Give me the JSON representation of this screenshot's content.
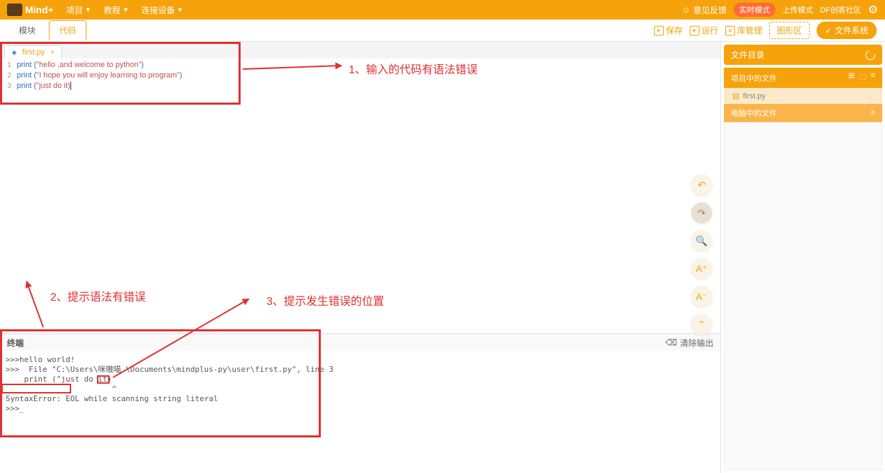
{
  "header": {
    "logo": "Mind+",
    "menu": {
      "project": "项目",
      "tutorial": "教程",
      "connect": "连接设备"
    },
    "feedback": "意见反馈",
    "mode_realtime": "实时模式",
    "mode_upload": "上传模式",
    "community": "DF创客社区"
  },
  "subbar": {
    "tab_block": "模块",
    "tab_code": "代码",
    "save": "保存",
    "run": "运行",
    "lib": "库管理",
    "graph": "图形区",
    "filesys": "文件系统"
  },
  "editor": {
    "filename": "first.py",
    "lines": [
      {
        "n": "1",
        "pre": "print (",
        "str": "\"hello ,and welcome to python\"",
        "post": ")"
      },
      {
        "n": "2",
        "pre": "print (",
        "str": "\"I hope you will enjoy learning to program\"",
        "post": ")"
      },
      {
        "n": "3",
        "pre": "print (",
        "str": "\"just do it)",
        "post": ""
      }
    ]
  },
  "annotations": {
    "a1": "1、输入的代码有语法错误",
    "a2": "2、提示语法有错误",
    "a3": "3、提示发生错误的位置"
  },
  "terminal": {
    "title": "终端",
    "clear": "清除输出",
    "body": ">>>hello world!\n>>>  File \"C:\\Users\\咪嗷喵 \\Documents\\mindplus-py\\user\\first.py\", line 3\n    print (\"just do it)\n                       ^\nSyntaxError: EOL while scanning string literal\n>>>_"
  },
  "sidebar": {
    "title": "文件目录",
    "project_files": "项目中的文件",
    "file1": "first.py",
    "computer_files": "电脑中的文件"
  }
}
